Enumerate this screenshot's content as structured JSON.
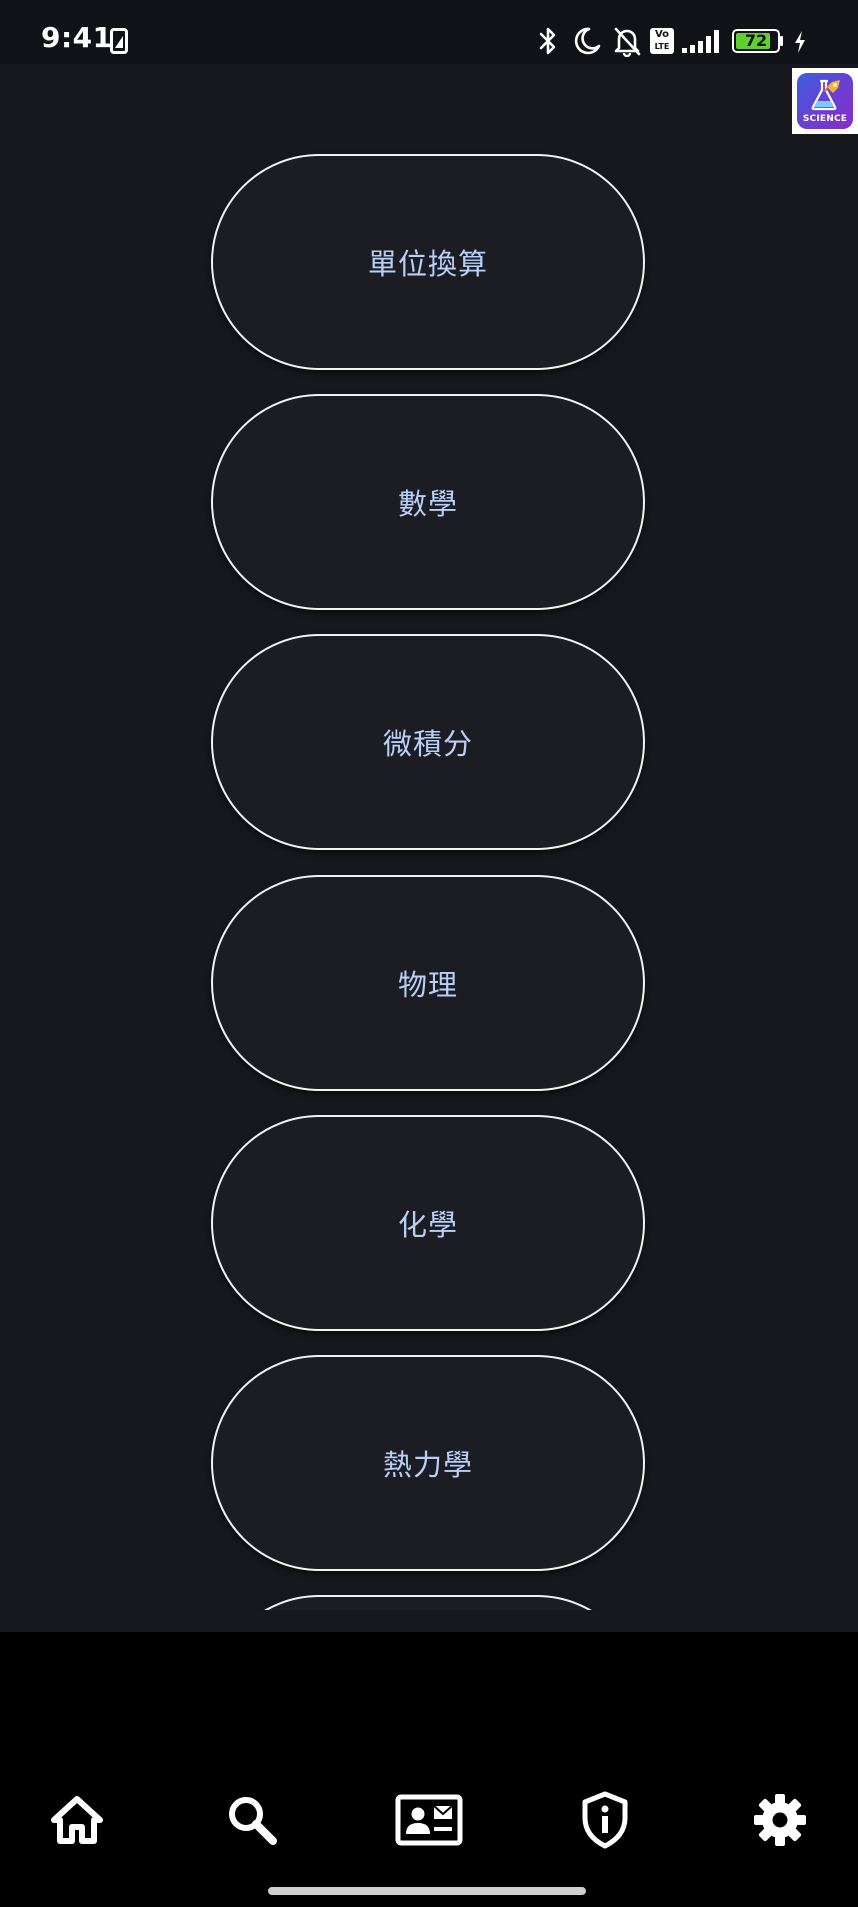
{
  "status_bar": {
    "time": "9:41",
    "battery_level": "72",
    "icons": [
      "screenshot-icon",
      "bluetooth-icon",
      "dnd-moon-icon",
      "bell-off-icon",
      "volte-icon",
      "signal-icon",
      "battery-icon",
      "charging-icon"
    ],
    "volte_top": "Vo",
    "volte_bottom": "LTE",
    "battery_color": "#5fd02c"
  },
  "app_logo": {
    "text": "SCIENCE",
    "icon": "flask-rocket-icon"
  },
  "categories": [
    {
      "label": "單位換算"
    },
    {
      "label": "數學"
    },
    {
      "label": "微積分"
    },
    {
      "label": "物理"
    },
    {
      "label": "化學"
    },
    {
      "label": "熱力學"
    },
    {
      "label": ""
    }
  ],
  "bottom_nav": {
    "items": [
      {
        "icon": "home-icon"
      },
      {
        "icon": "search-icon"
      },
      {
        "icon": "contact-card-icon"
      },
      {
        "icon": "shield-info-icon"
      },
      {
        "icon": "settings-gear-icon"
      }
    ]
  },
  "colors": {
    "background": "#16181e",
    "button_fill": "#1b1d23",
    "button_border": "#f2f2f2",
    "button_text": "#b8cff7",
    "nav_background": "#000000"
  }
}
